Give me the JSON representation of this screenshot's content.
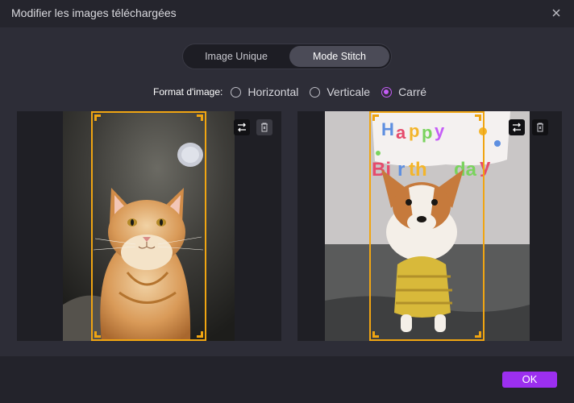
{
  "dialog": {
    "title": "Modifier les images téléchargées"
  },
  "mode": {
    "tabs": [
      "Image Unique",
      "Mode Stitch"
    ],
    "selected": "Mode Stitch"
  },
  "format": {
    "label": "Format d'image:",
    "options": [
      "Horizontal",
      "Verticale",
      "Carré"
    ],
    "selected": "Carré"
  },
  "images": [
    {
      "subject": "cat",
      "tools": [
        "swap-icon",
        "delete-icon"
      ]
    },
    {
      "subject": "dog",
      "tools": [
        "swap-icon",
        "delete-icon"
      ]
    }
  ],
  "footer": {
    "ok_label": "OK"
  },
  "colors": {
    "accent": "#9c2ff0",
    "radio_checked": "#c55df7",
    "crop_border": "#f0a512"
  }
}
